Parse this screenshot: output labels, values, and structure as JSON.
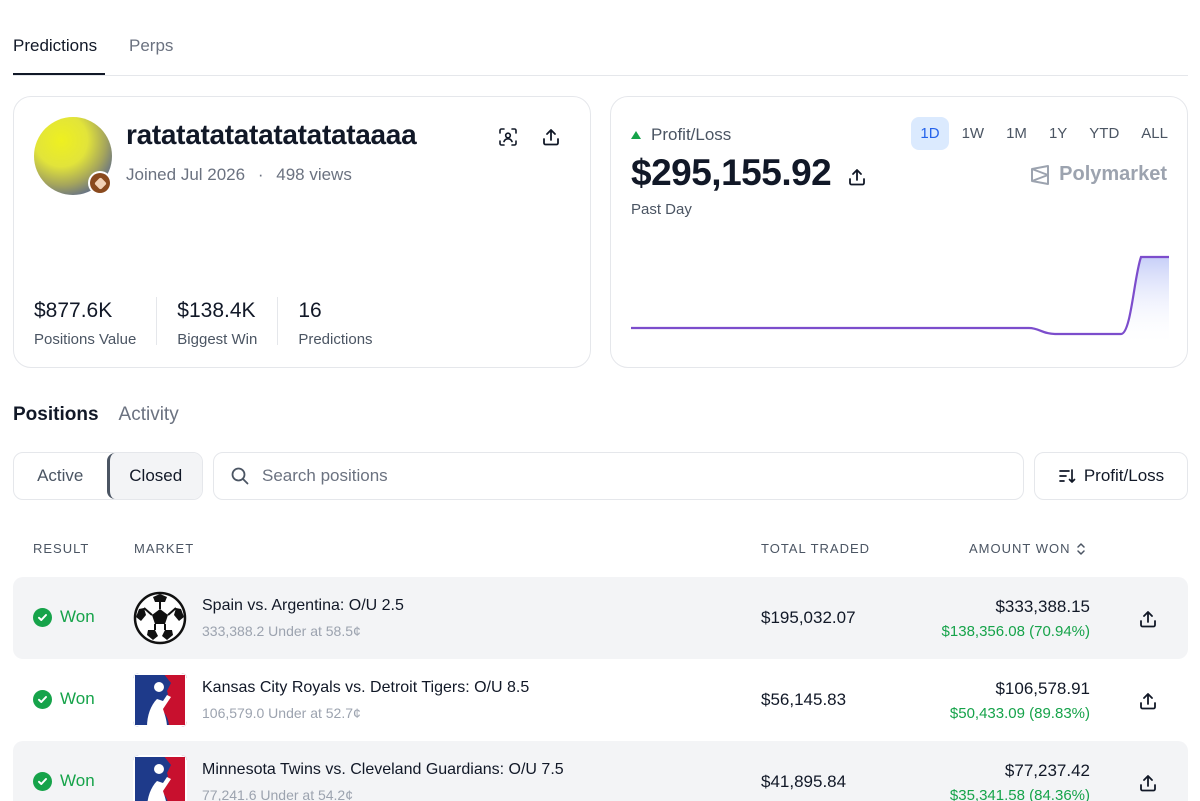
{
  "top_tabs": {
    "predictions": "Predictions",
    "perps": "Perps"
  },
  "profile": {
    "username": "ratatatatatatatatataaaa",
    "joined": "Joined Jul 2026",
    "separator": "·",
    "views": "498 views",
    "stats": [
      {
        "value": "$877.6K",
        "label": "Positions Value"
      },
      {
        "value": "$138.4K",
        "label": "Biggest Win"
      },
      {
        "value": "16",
        "label": "Predictions"
      }
    ]
  },
  "pnl": {
    "label": "Profit/Loss",
    "amount": "$295,155.92",
    "period": "Past Day",
    "brand": "Polymarket",
    "ranges": [
      "1D",
      "1W",
      "1M",
      "1Y",
      "YTD",
      "ALL"
    ],
    "active_range": "1D",
    "line_color": "#7c4dcc",
    "accent_color": "#2563eb"
  },
  "positions": {
    "section_tabs": {
      "positions": "Positions",
      "activity": "Activity"
    },
    "filter": {
      "active": "Active",
      "closed": "Closed"
    },
    "search_placeholder": "Search positions",
    "sort_label": "Profit/Loss",
    "columns": {
      "result": "RESULT",
      "market": "MARKET",
      "total_traded": "TOTAL TRADED",
      "amount_won": "AMOUNT WON"
    },
    "rows": [
      {
        "result": "Won",
        "icon": "soccer-ball-icon",
        "title": "Spain vs. Argentina: O/U 2.5",
        "subtitle": "333,388.2 Under at 58.5¢",
        "traded": "$195,032.07",
        "won": "$333,388.15",
        "profit": "$138,356.08 (70.94%)"
      },
      {
        "result": "Won",
        "icon": "mlb-logo-icon",
        "title": "Kansas City Royals vs. Detroit Tigers: O/U 8.5",
        "subtitle": "106,579.0 Under at 52.7¢",
        "traded": "$56,145.83",
        "won": "$106,578.91",
        "profit": "$50,433.09 (89.83%)"
      },
      {
        "result": "Won",
        "icon": "mlb-logo-icon",
        "title": "Minnesota Twins vs. Cleveland Guardians: O/U 7.5",
        "subtitle": "77,241.6 Under at 54.2¢",
        "traded": "$41,895.84",
        "won": "$77,237.42",
        "profit": "$35,341.58 (84.36%)"
      }
    ]
  }
}
